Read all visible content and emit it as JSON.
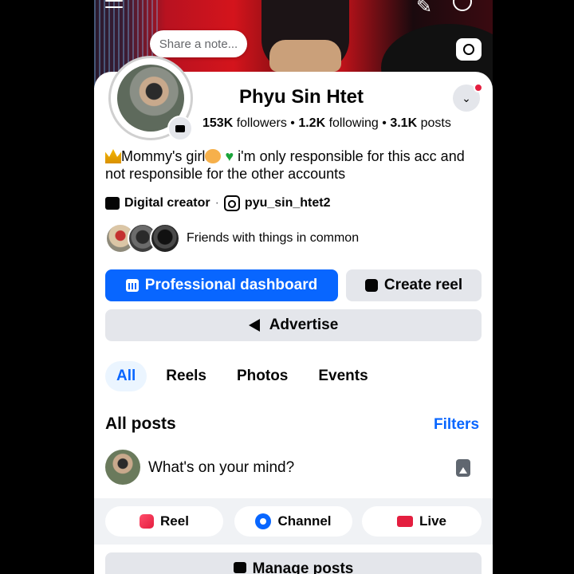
{
  "profile": {
    "note_placeholder": "Share a note...",
    "name": "Phyu Sin Htet",
    "followers_count": "153K",
    "followers_label": " followers",
    "following_count": "1.2K",
    "following_label": " following",
    "posts_count": "3.1K",
    "posts_label": " posts",
    "bio_part1": "Mommy's girl",
    "bio_part2": " i'm only responsible for this acc and not responsible for the other accounts",
    "category": "Digital creator",
    "instagram": "pyu_sin_htet2",
    "friends_text": "Friends with things in common"
  },
  "buttons": {
    "professional": "Professional dashboard",
    "create_reel": "Create reel",
    "advertise": "Advertise",
    "manage_posts": "Manage posts"
  },
  "tabs": [
    "All",
    "Reels",
    "Photos",
    "Events"
  ],
  "posts": {
    "section_title": "All posts",
    "filters": "Filters",
    "composer_prompt": "What's on your mind?"
  },
  "composer_actions": {
    "reel": "Reel",
    "channel": "Channel",
    "live": "Live"
  },
  "colors": {
    "accent": "#0866ff",
    "button_gray": "#e4e6eb",
    "live_red": "#e41e3f"
  }
}
